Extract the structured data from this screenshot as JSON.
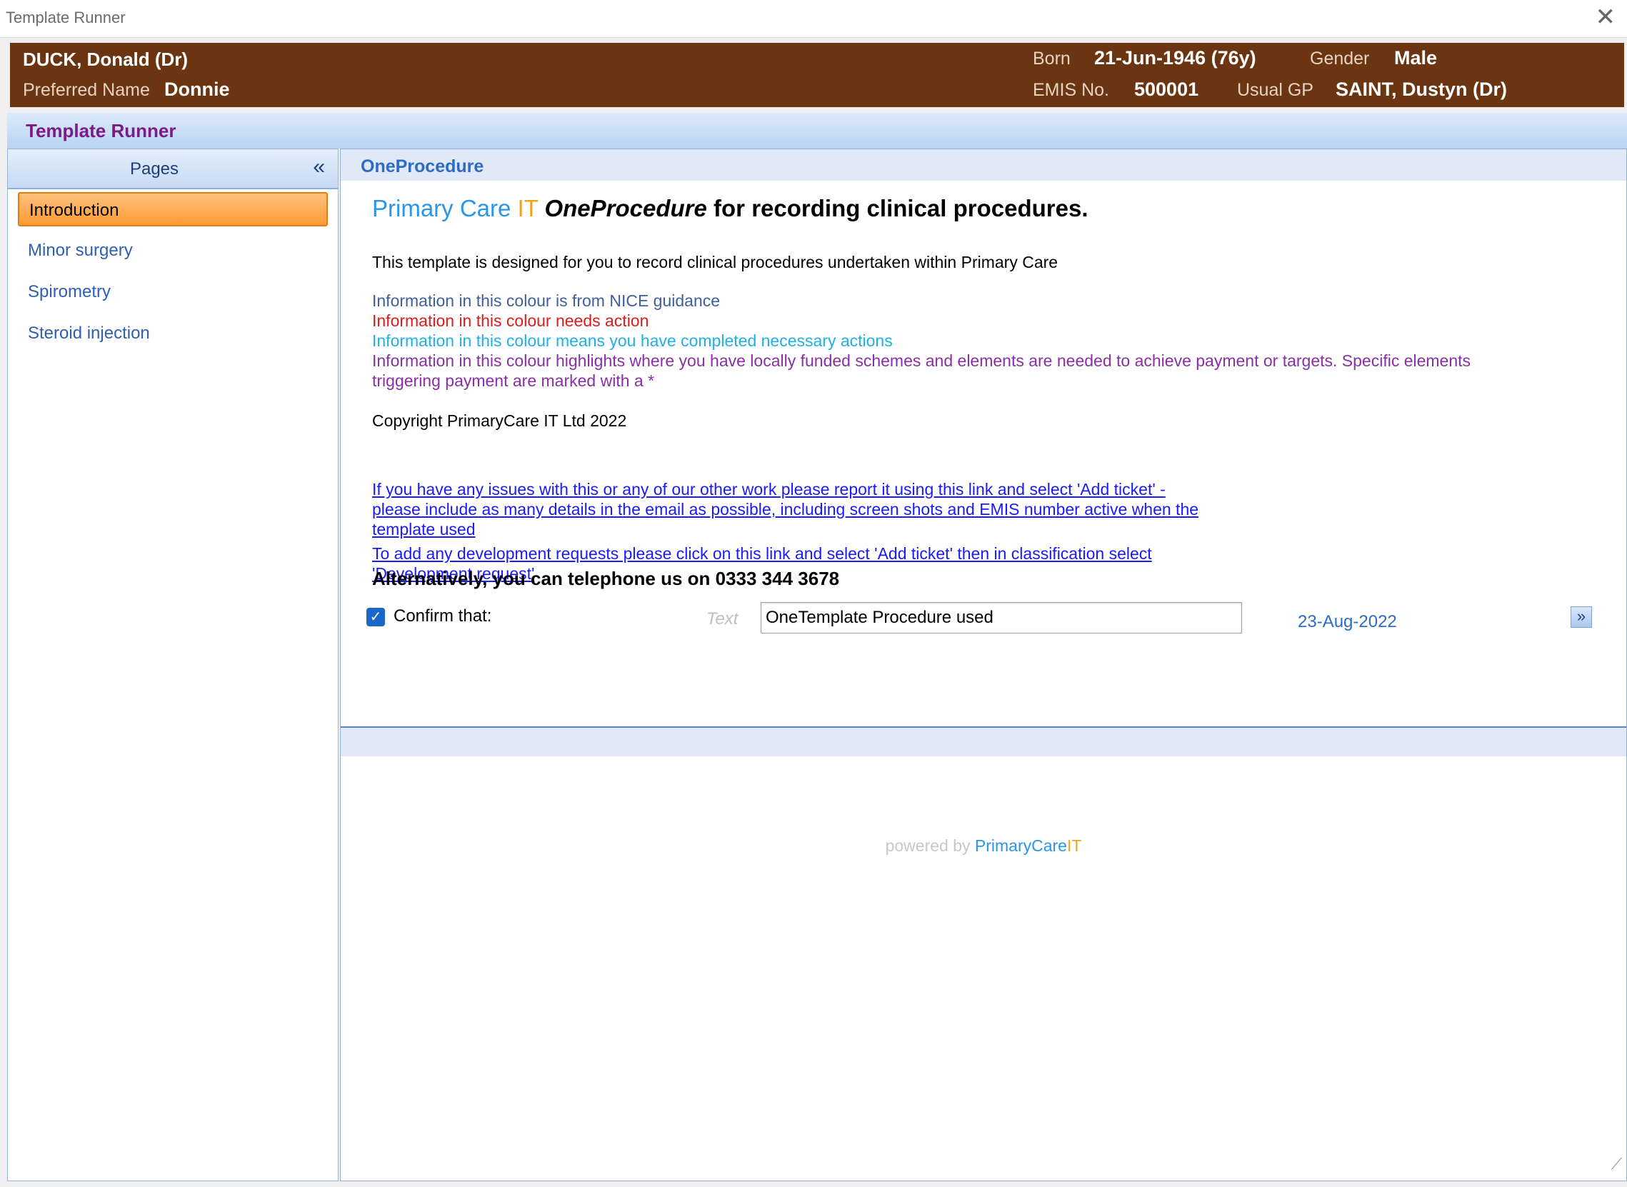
{
  "window": {
    "title": "Template Runner",
    "close_glyph": "✕"
  },
  "patient": {
    "name": "DUCK, Donald (Dr)",
    "preferred_label": "Preferred Name",
    "preferred_value": "Donnie",
    "born_label": "Born",
    "born_value": "21-Jun-1946 (76y)",
    "gender_label": "Gender",
    "gender_value": "Male",
    "emis_label": "EMIS No.",
    "emis_value": "500001",
    "gp_label": "Usual GP",
    "gp_value": "SAINT, Dustyn (Dr)"
  },
  "runner": {
    "title": "Template Runner"
  },
  "sidebar": {
    "title": "Pages",
    "collapse_glyph": "«",
    "items": [
      {
        "label": "Introduction",
        "active": true
      },
      {
        "label": "Minor surgery",
        "active": false
      },
      {
        "label": "Spirometry",
        "active": false
      },
      {
        "label": "Steroid injection",
        "active": false
      }
    ]
  },
  "section": {
    "title": "OneProcedure",
    "heading": {
      "primary": "Primary Care",
      "it": "IT",
      "product": "OneProcedure",
      "rest": "for recording clinical procedures."
    },
    "description": "This template is designed for you to record clinical procedures undertaken within Primary Care",
    "legend": {
      "nice": "Information in this colour is from NICE guidance",
      "action": "Information in this colour needs action",
      "done": "Information in this colour means you have completed necessary actions",
      "local_1": "Information in this colour highlights where you have locally funded schemes and elements are needed to achieve payment or targets.  Specific elements",
      "local_2": "triggering payment are marked with a *"
    },
    "copyright": "Copyright PrimaryCare IT Ltd 2022",
    "link_issues": {
      "line1": "If you have any issues with this or any of our other work please report it using this link and select 'Add ticket' -",
      "line2": "please include as many details in the email as possible, including screen shots and EMIS number active when the",
      "line3": "template used"
    },
    "link_dev": {
      "line1": "To add any development requests please click on this link and select 'Add ticket' then in classification select",
      "line2": "'Development request'"
    },
    "phone": "Alternatively, you can telephone us on 0333 344 3678",
    "confirm": {
      "checked": true,
      "check_glyph": "✓",
      "label": "Confirm that:",
      "text_hint": "Text",
      "value": "OneTemplate Procedure used",
      "date": "23-Aug-2022",
      "next_glyph": "»"
    }
  },
  "footer": {
    "powered_by": "powered by",
    "brand_primary": "PrimaryCare",
    "brand_it": "IT"
  },
  "colors": {
    "patient_banner": "#6b3511",
    "runner_title": "#7a1b86",
    "nice": "#3e5f9a",
    "action": "#e01b1b",
    "done": "#1fb0e6",
    "local": "#8a2fa6",
    "link": "#1a1aff",
    "brand_blue": "#2b95e8",
    "brand_orange": "#f0a41e",
    "active_page": "#ff9a33"
  }
}
